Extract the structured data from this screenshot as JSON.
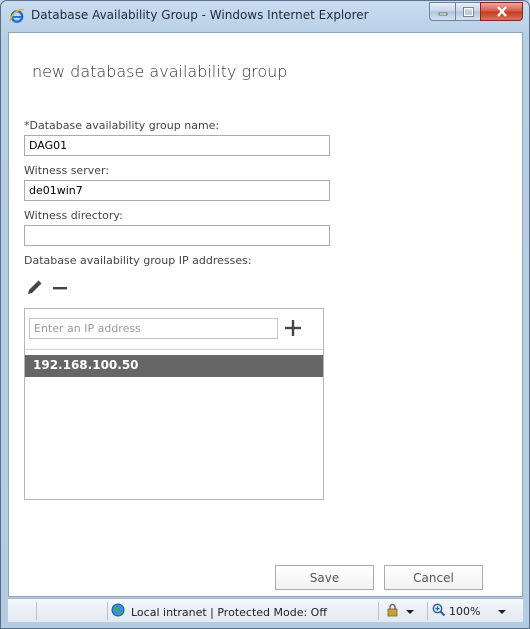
{
  "window": {
    "title": "Database Availability Group - Windows Internet Explorer"
  },
  "dialog": {
    "title": "new database availability group",
    "fields": {
      "name_label": "*Database availability group name:",
      "name_value": "DAG01",
      "witness_server_label": "Witness server:",
      "witness_server_value": "de01win7",
      "witness_directory_label": "Witness directory:",
      "witness_directory_value": "",
      "ip_addresses_label": "Database availability group IP addresses:"
    },
    "ip_panel": {
      "placeholder": "Enter an IP address",
      "addresses": [
        "192.168.100.50"
      ]
    },
    "buttons": {
      "save": "Save",
      "cancel": "Cancel"
    }
  },
  "statusbar": {
    "zone": "Local intranet | Protected Mode: Off",
    "zoom": "100%"
  },
  "icons": {
    "browser": "internet-explorer-icon",
    "edit": "pencil-icon",
    "remove": "minus-icon",
    "add": "plus-icon",
    "zone": "globe-icon",
    "security": "lock-icon",
    "zoom": "magnifier-icon"
  },
  "colors": {
    "selected_row": "#666666",
    "title_text": "#333333"
  }
}
